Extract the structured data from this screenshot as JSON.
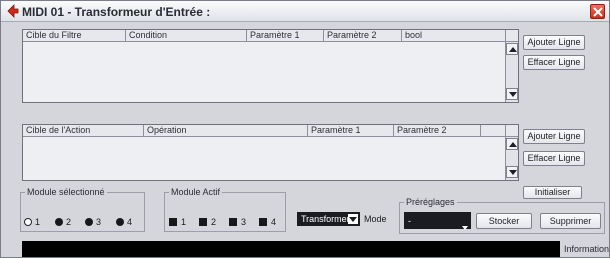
{
  "window": {
    "title": "MIDI 01 - Transformeur d'Entrée :"
  },
  "filter_table": {
    "columns": [
      "Cible du Filtre",
      "Condition",
      "Paramètre 1",
      "Paramètre 2",
      "bool"
    ],
    "add_label": "Ajouter Ligne",
    "delete_label": "Effacer Ligne"
  },
  "action_table": {
    "columns": [
      "Cible de l'Action",
      "Opération",
      "Paramètre 1",
      "Paramètre 2"
    ],
    "add_label": "Ajouter Ligne",
    "delete_label": "Effacer Ligne"
  },
  "module_selected": {
    "label": "Module sélectionné",
    "options": [
      "1",
      "2",
      "3",
      "4"
    ],
    "selected": "1"
  },
  "module_active": {
    "label": "Module Actif",
    "options": [
      "1",
      "2",
      "3",
      "4"
    ]
  },
  "mode": {
    "value": "Transformer",
    "label": "Mode"
  },
  "initialize_label": "Initialiser",
  "presets": {
    "label": "Préréglages",
    "value": "-",
    "store_label": "Stocker",
    "delete_label": "Supprimer"
  },
  "info_label": "Information",
  "colors": {
    "close": "#d8402a",
    "title_icon": "#cf2a1c",
    "dark": "#1b1c22"
  }
}
